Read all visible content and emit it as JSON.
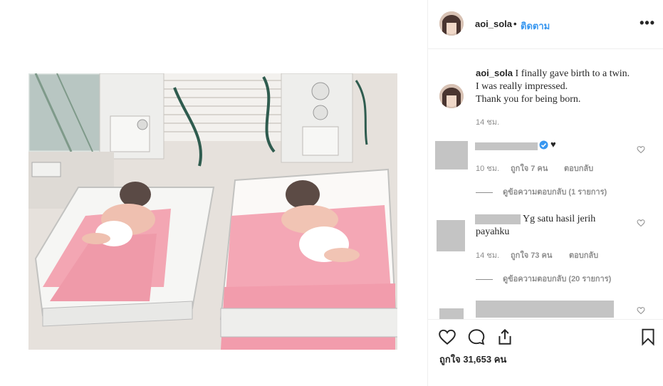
{
  "post": {
    "username": "aoi_sola",
    "separator": "•",
    "follow_label": "ติดตาม",
    "more_label": "•••",
    "caption": {
      "username": "aoi_sola",
      "lines": [
        "I finally gave birth to a twin.",
        "I was really impressed.",
        "Thank you for being born."
      ],
      "time": "14 ชม."
    },
    "comments": [
      {
        "text": "",
        "verified_icon": "verified-badge-icon",
        "emoji": "♥",
        "time": "10 ชม.",
        "likes": "ถูกใจ 7 คน",
        "reply_label": "ตอบกลับ",
        "view_replies": "ดูข้อความตอบกลับ (1 รายการ)"
      },
      {
        "text_line1": "Yg satu hasil jerih",
        "text_line2": "payahku",
        "time": "14 ชม.",
        "likes": "ถูกใจ 73 คน",
        "reply_label": "ตอบกลับ",
        "view_replies": "ดูข้อความตอบกลับ (20 รายการ)"
      }
    ],
    "likes_total": "ถูกใจ 31,653 คน"
  },
  "icons": {
    "like": "heart-icon",
    "comment": "comment-bubble-icon",
    "share": "share-icon",
    "save": "bookmark-icon",
    "comment_like": "small-heart-icon"
  },
  "colors": {
    "link_blue": "#3897f0",
    "text": "#262626",
    "muted": "#8e8e8e",
    "redacted_grey": "#c4c4c4"
  }
}
